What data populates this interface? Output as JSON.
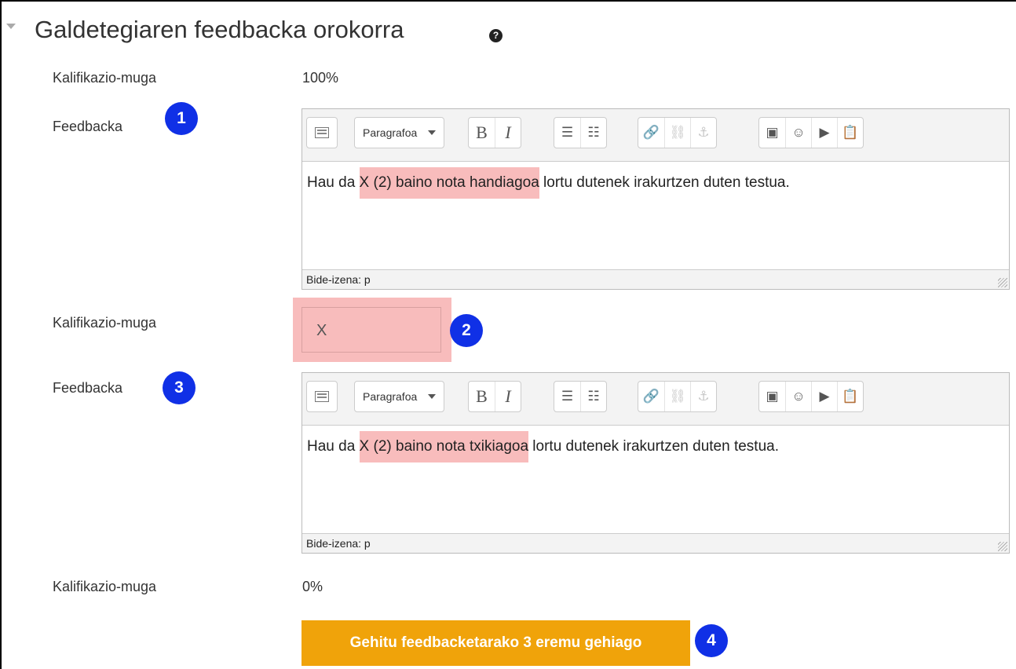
{
  "section": {
    "title": "Galdetegiaren feedbacka orokorra",
    "help_icon": "?"
  },
  "rows": {
    "boundary1": {
      "label": "Kalifikazio-muga",
      "value": "100%"
    },
    "feedback1": {
      "label": "Feedbacka"
    },
    "boundary2": {
      "label": "Kalifikazio-muga",
      "input_value": "X"
    },
    "feedback2": {
      "label": "Feedbacka"
    },
    "boundary3": {
      "label": "Kalifikazio-muga",
      "value": "0%"
    }
  },
  "editors": [
    {
      "paragraph_select": "Paragrafoa",
      "content_before": "Hau da ",
      "content_highlight": "X (2) baino nota handiagoa",
      "content_after": " lortu dutenek irakurtzen duten testua.",
      "path": "Bide-izena: p"
    },
    {
      "paragraph_select": "Paragrafoa",
      "content_before": "Hau da ",
      "content_highlight": "X (2) baino nota txikiagoa",
      "content_after": " lortu dutenek irakurtzen duten testua.",
      "path": "Bide-izena: p"
    }
  ],
  "toolbar_icons": {
    "bold": "B",
    "italic": "I",
    "bullets": "☰",
    "numbered": "☷",
    "link": "🔗",
    "unlink": "⛓",
    "anchor": "⚓",
    "image": "▣",
    "emoji": "☺",
    "media": "▶",
    "paste": "📋"
  },
  "add_button": {
    "label": "Gehitu feedbacketarako 3 eremu gehiago"
  },
  "markers": [
    "1",
    "2",
    "3",
    "4"
  ],
  "colors": {
    "highlight": "#f8bcbc",
    "marker": "#1030e6",
    "button": "#f0a30a"
  }
}
